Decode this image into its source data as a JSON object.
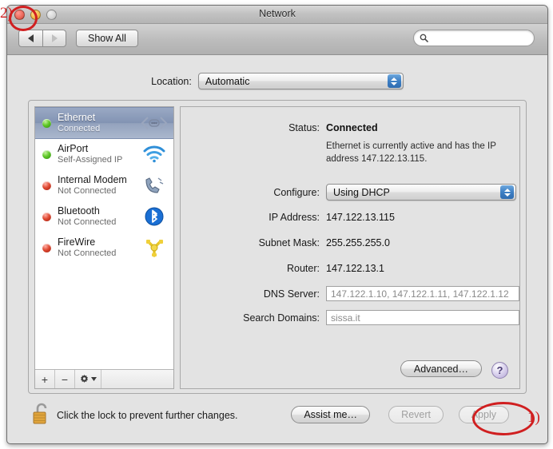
{
  "window": {
    "title": "Network",
    "traffic": {
      "close": "close-button",
      "minimize": "minimize-button",
      "zoom": "zoom-button"
    }
  },
  "toolbar": {
    "back_label": "◀",
    "forward_label": "▶",
    "show_all_label": "Show All",
    "search_placeholder": "",
    "search_value": ""
  },
  "location": {
    "label": "Location:",
    "selected": "Automatic",
    "options": [
      "Automatic"
    ]
  },
  "sidebar": {
    "services": [
      {
        "name": "Ethernet",
        "state": "Connected",
        "status": "green",
        "icon": "ethernet-icon",
        "selected": true
      },
      {
        "name": "AirPort",
        "state": "Self-Assigned IP",
        "status": "green",
        "icon": "airport-icon",
        "selected": false
      },
      {
        "name": "Internal Modem",
        "state": "Not Connected",
        "status": "red",
        "icon": "modem-icon",
        "selected": false
      },
      {
        "name": "Bluetooth",
        "state": "Not Connected",
        "status": "red",
        "icon": "bluetooth-icon",
        "selected": false
      },
      {
        "name": "FireWire",
        "state": "Not Connected",
        "status": "red",
        "icon": "firewire-icon",
        "selected": false
      }
    ],
    "toolbar": {
      "add_label": "+",
      "remove_label": "−",
      "action_label": "gear-icon"
    }
  },
  "detail": {
    "status_label": "Status:",
    "status_value": "Connected",
    "status_description": "Ethernet is currently active and has the IP address 147.122.13.115.",
    "configure_label": "Configure:",
    "configure_value": "Using DHCP",
    "configure_options": [
      "Using DHCP"
    ],
    "ip_label": "IP Address:",
    "ip_value": "147.122.13.115",
    "subnet_label": "Subnet Mask:",
    "subnet_value": "255.255.255.0",
    "router_label": "Router:",
    "router_value": "147.122.13.1",
    "dns_label": "DNS Server:",
    "dns_value": "147.122.1.10, 147.122.1.11, 147.122.1.12",
    "search_domains_label": "Search Domains:",
    "search_domains_value": "sissa.it",
    "advanced_label": "Advanced…",
    "help_label": "?"
  },
  "bottom": {
    "lock_icon": "unlocked-padlock-icon",
    "lock_text": "Click the lock to prevent further changes.",
    "assist_label": "Assist me…",
    "revert_label": "Revert",
    "apply_label": "Apply"
  },
  "annotations": {
    "apply_marker": "1)",
    "close_marker": "2)",
    "color": "#d01f20"
  }
}
